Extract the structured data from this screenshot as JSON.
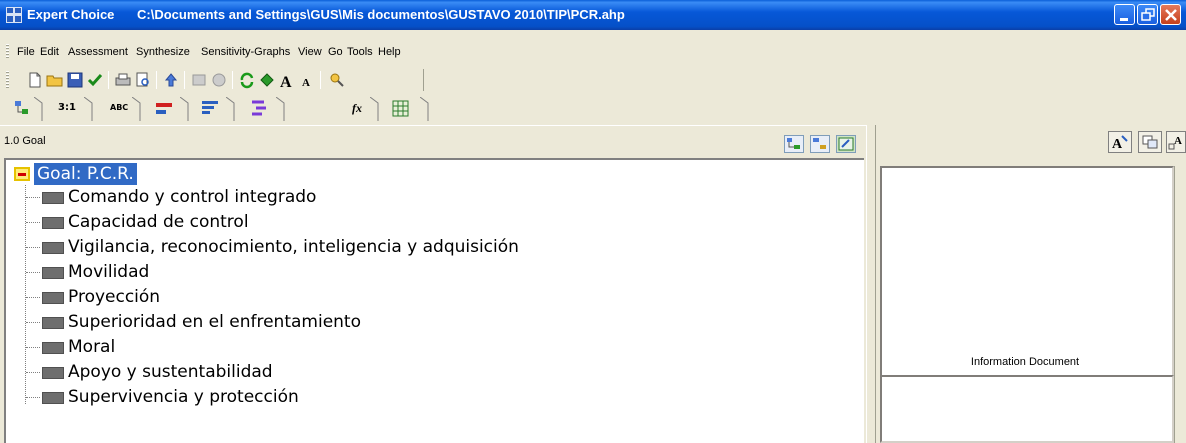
{
  "window": {
    "app_name": "Expert Choice",
    "file_path": "C:\\Documents and Settings\\GUS\\Mis documentos\\GUSTAVO 2010\\TIP\\PCR.ahp"
  },
  "menu": [
    {
      "label": "File"
    },
    {
      "label": "Edit"
    },
    {
      "label": "Assessment"
    },
    {
      "label": "Synthesize"
    },
    {
      "label": "Sensitivity-Graphs"
    },
    {
      "label": "View"
    },
    {
      "label": "Go"
    },
    {
      "label": "Tools"
    },
    {
      "label": "Help"
    }
  ],
  "tabs": [
    {
      "label": ""
    },
    {
      "label": "3:1"
    },
    {
      "label": "ABC"
    },
    {
      "label": ""
    },
    {
      "label": ""
    },
    {
      "label": ""
    },
    {
      "label": "fx"
    },
    {
      "label": ""
    }
  ],
  "left_panel": {
    "header_label": "1.0 Goal"
  },
  "tree": {
    "root_label": "Goal: P.C.R.",
    "items": [
      {
        "label": "Comando y control integrado"
      },
      {
        "label": "Capacidad de control"
      },
      {
        "label": "Vigilancia, reconocimiento, inteligencia y adquisición"
      },
      {
        "label": "Movilidad"
      },
      {
        "label": "Proyección"
      },
      {
        "label": "Superioridad en el enfrentamiento"
      },
      {
        "label": "Moral"
      },
      {
        "label": "Apoyo y sustentabilidad"
      },
      {
        "label": "Supervivencia y protección"
      }
    ]
  },
  "right_panel": {
    "info_label": "Information Document"
  },
  "colors": {
    "titlebar": "#0a5fd8",
    "selection": "#316ac5",
    "node": "#6e6e6e",
    "close_button": "#c6401b"
  }
}
